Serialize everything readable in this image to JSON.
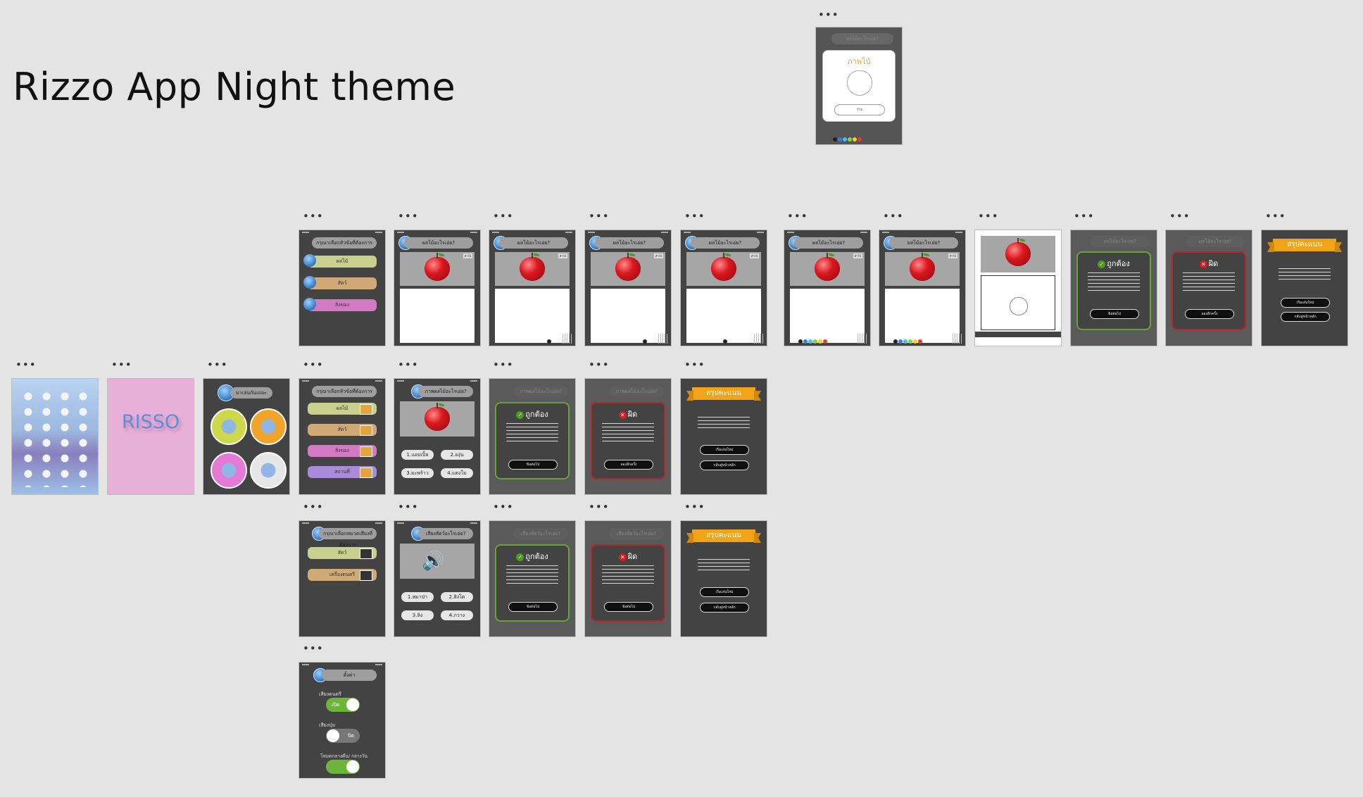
{
  "title": "Rizzo App Night theme",
  "dots": "•••",
  "palette_colors": [
    "#222222",
    "#3d7be0",
    "#3fc0ff",
    "#7fd14a",
    "#f2d21a",
    "#e23b30"
  ],
  "colors": {
    "canvas_bg": "#e4e4e4",
    "artboard_bg": "#434343",
    "correct": "#6aa238",
    "wrong": "#b3262c",
    "accent": "#f3a318"
  },
  "modal": {
    "header": "ผลไม้อะไรเอ่ย?",
    "title": "ภาพไบ้",
    "button": "ร่าง"
  },
  "menu1": {
    "header": "กรุณาเลือกหัวข้อที่ต้องการ",
    "items": [
      "ผลไม้",
      "สัตว์",
      "สิ่งของ"
    ]
  },
  "menu2": {
    "header": "กรุณาเลือกหัวข้อที่ต้องการ",
    "items": [
      "ผลไม้",
      "สัตว์",
      "สิ่งของ",
      "สถานที่"
    ]
  },
  "menu3": {
    "header": "กรุณาเลือกหมวดเสียงที่ต้องการ",
    "items": [
      "สัตว์",
      "เครื่องดนตรี"
    ]
  },
  "quiz": {
    "header": "ผลไม้อะไรเอ่ย?",
    "pic_tag": "คำใบ้"
  },
  "picquiz": {
    "header": "ภาพผลไม้อะไรเอ่ย?",
    "choices": [
      "1.แอปเปิ้ล",
      "2.องุ่น",
      "3.มะพร้าว",
      "4.แตงโม"
    ]
  },
  "soundquiz": {
    "header": "เสียงสัตว์อะไรเอ่ย?",
    "speaker_icon": "speaker-icon",
    "choices": [
      "1.หมาป่า",
      "2.สิงโต",
      "3.ลิง",
      "4.กวาง"
    ]
  },
  "result": {
    "correct": "ถูกต้อง",
    "wrong": "ผิด",
    "next": "ข้อต่อไป",
    "retry": "ลองอีกครั้ง",
    "check": "✓",
    "cross": "✕"
  },
  "summary": {
    "title": "สรุปคะแนน",
    "btn_new": "เริ่มเล่นใหม่",
    "btn_home": "กลับสู่หน้าหลัก"
  },
  "splash": {
    "brand": "RISSO"
  },
  "home": {
    "header": "มาเล่นกันเถอะ"
  },
  "settings": {
    "header": "ตั้งค่า",
    "music_label": "เสียงดนตรี",
    "music_state": "เปิด",
    "button_label": "เสียงปุ่ม",
    "button_state": "ปิด",
    "theme_label": "โหมดกลางคืน/ กลางวัน"
  }
}
